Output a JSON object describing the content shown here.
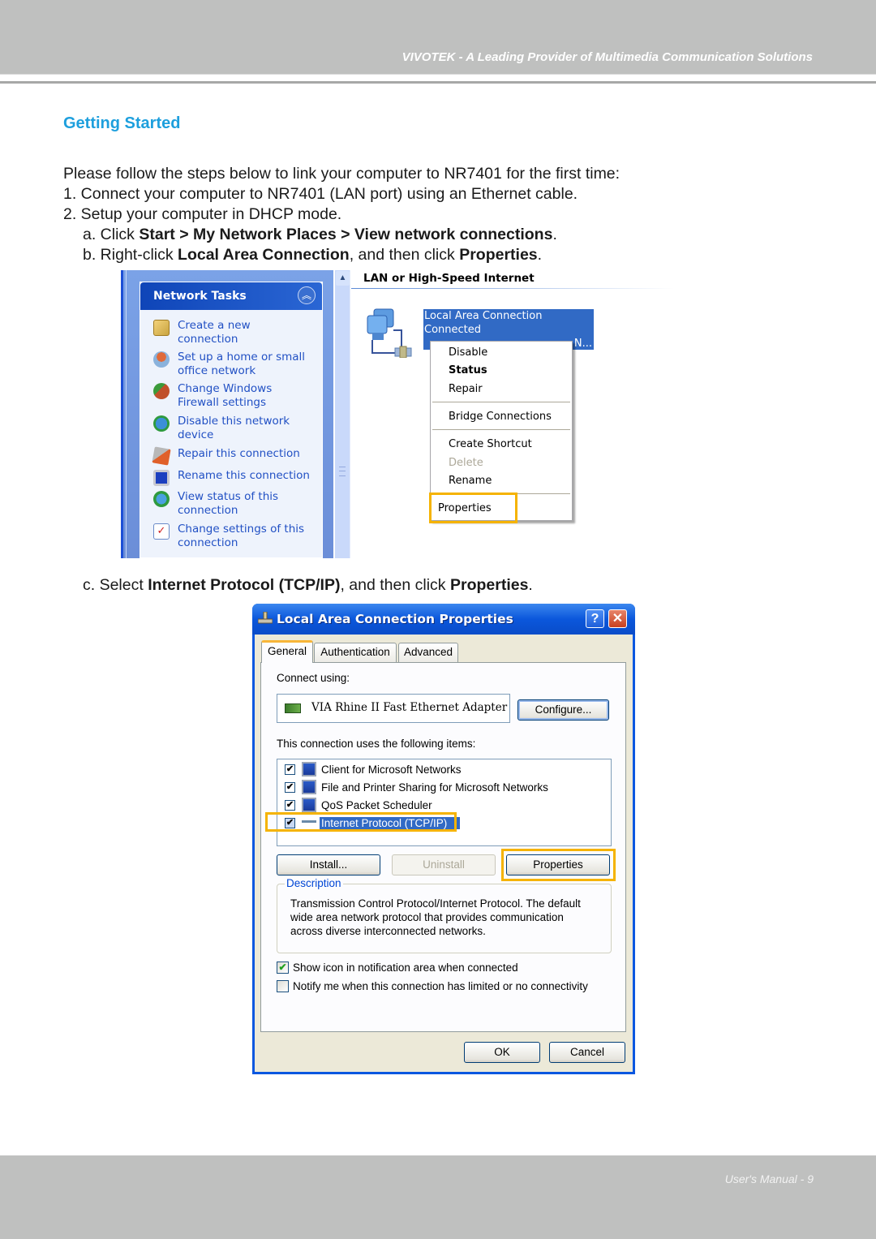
{
  "header": {
    "tagline": "VIVOTEK - A Leading Provider of Multimedia Communication Solutions"
  },
  "section": {
    "title": "Getting Started"
  },
  "body": {
    "intro": "Please follow the steps below to link your computer to NR7401 for the first time:",
    "step1": "1. Connect your computer to NR7401 (LAN port) using an Ethernet cable.",
    "step2": "2. Setup your computer in DHCP mode.",
    "step2a": {
      "prefix": "a. Click ",
      "bold": "Start > My Network Places > View network connections",
      "suffix": "."
    },
    "step2b": {
      "prefix": "b. Right-click ",
      "bold1": "Local Area Connection",
      "middle": ", and then click ",
      "bold2": "Properties",
      "suffix": "."
    },
    "step2c": {
      "prefix": "c. Select ",
      "bold1": "Internet Protocol (TCP/IP)",
      "middle": ", and then click ",
      "bold2": "Properties",
      "suffix": "."
    }
  },
  "screenshot1": {
    "task_pane": {
      "title": "Network Tasks",
      "collapse_glyph": "︽",
      "tasks": [
        {
          "icon": "new-connection-icon",
          "line1": "Create a new",
          "line2": "connection"
        },
        {
          "icon": "home-network-icon",
          "line1": "Set up a home or small",
          "line2": "office network"
        },
        {
          "icon": "firewall-icon",
          "line1": "Change Windows",
          "line2": "Firewall settings"
        },
        {
          "icon": "disable-device-icon",
          "line1": "Disable this network",
          "line2": "device"
        },
        {
          "icon": "repair-icon",
          "line1": "Repair this connection",
          "line2": ""
        },
        {
          "icon": "rename-icon",
          "line1": "Rename this connection",
          "line2": ""
        },
        {
          "icon": "view-status-icon",
          "line1": "View status of this",
          "line2": "connection"
        },
        {
          "icon": "change-settings-icon",
          "line1": "Change settings of this",
          "line2": "connection"
        }
      ]
    },
    "group_title": "LAN or High-Speed Internet",
    "connection": {
      "name": "Local Area Connection",
      "status": "Connected",
      "truncated_suffix": "N..."
    },
    "context_menu": {
      "items": [
        {
          "label": "Disable",
          "style": "normal"
        },
        {
          "label": "Status",
          "style": "bold"
        },
        {
          "label": "Repair",
          "style": "normal"
        },
        {
          "label": "Bridge Connections",
          "style": "normal"
        },
        {
          "label": "Create Shortcut",
          "style": "normal"
        },
        {
          "label": "Delete",
          "style": "disabled"
        },
        {
          "label": "Rename",
          "style": "normal"
        },
        {
          "label": "Properties",
          "style": "highlighted"
        }
      ]
    }
  },
  "dialog": {
    "title": "Local Area Connection Properties",
    "help_glyph": "?",
    "close_glyph": "✕",
    "tabs": [
      "General",
      "Authentication",
      "Advanced"
    ],
    "active_tab": "General",
    "connect_using_label": "Connect using:",
    "adapter_name": "VIA Rhine II Fast Ethernet Adapter",
    "configure_button": "Configure...",
    "items_label": "This connection uses the following items:",
    "items": [
      {
        "label": "Client for Microsoft Networks",
        "checked": true,
        "selected": false
      },
      {
        "label": "File and Printer Sharing for Microsoft Networks",
        "checked": true,
        "selected": false
      },
      {
        "label": "QoS Packet Scheduler",
        "checked": true,
        "selected": false
      },
      {
        "label": "Internet Protocol (TCP/IP)",
        "checked": true,
        "selected": true
      }
    ],
    "install_button": "Install...",
    "uninstall_button": "Uninstall",
    "properties_button": "Properties",
    "description_legend": "Description",
    "description_text": "Transmission Control Protocol/Internet Protocol. The default wide area network protocol that provides communication across diverse interconnected networks.",
    "option_show_icon": {
      "label": "Show icon in notification area when connected",
      "checked": true
    },
    "option_notify": {
      "label": "Notify me when this connection has limited or no connectivity",
      "checked": false
    },
    "ok_button": "OK",
    "cancel_button": "Cancel"
  },
  "footer": {
    "page_label": "User's Manual - 9"
  },
  "colors": {
    "heading_blue": "#1d9fdd",
    "highlight_orange": "#f5b300",
    "xp_selection": "#316ac5",
    "header_gray": "#bfc0bf"
  }
}
